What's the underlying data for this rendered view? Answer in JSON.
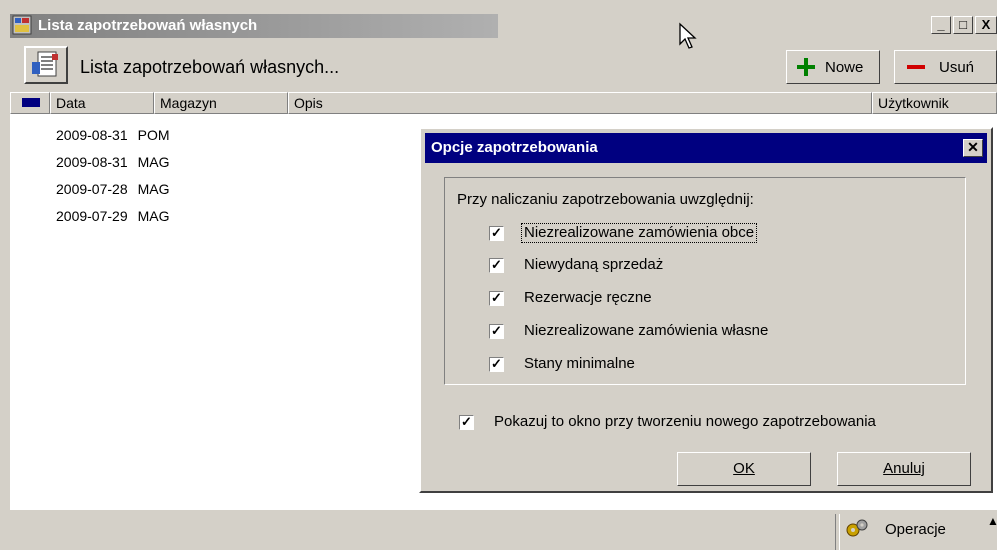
{
  "window": {
    "title": "Lista zapotrzebowań własnych",
    "minimize_label": "_",
    "maximize_label": "□",
    "close_label": "X"
  },
  "toolbar": {
    "title": "Lista zapotrzebowań własnych...",
    "new_label": "Nowe",
    "delete_label": "Usuń",
    "new_icon": "plus-icon",
    "delete_icon": "minus-icon"
  },
  "table": {
    "columns": [
      "Data",
      "Magazyn",
      "Opis",
      "Użytkownik"
    ],
    "rows": [
      {
        "date": "2009-08-31",
        "warehouse": "POM"
      },
      {
        "date": "2009-08-31",
        "warehouse": "MAG"
      },
      {
        "date": "2009-07-28",
        "warehouse": "MAG"
      },
      {
        "date": "2009-07-29",
        "warehouse": "MAG"
      }
    ]
  },
  "statusbar": {
    "operations_label": "Operacje",
    "operations_icon": "gears-icon"
  },
  "dialog": {
    "title": "Opcje zapotrzebowania",
    "close_label": "✕",
    "group_label": "Przy naliczaniu zapotrzebowania uwzględnij:",
    "options": [
      {
        "label": "Niezrealizowane zamówienia obce",
        "checked": true
      },
      {
        "label": "Niewydaną sprzedaż",
        "checked": true
      },
      {
        "label": "Rezerwacje ręczne",
        "checked": true
      },
      {
        "label": "Niezrealizowane zamówienia własne",
        "checked": true
      },
      {
        "label": "Stany minimalne",
        "checked": true
      }
    ],
    "show_on_new": {
      "label": "Pokazuj to okno przy tworzeniu nowego zapotrzebowania",
      "checked": true
    },
    "ok_label": "OK",
    "cancel_label": "Anuluj"
  },
  "colors": {
    "face": "#d4d0c8",
    "dialog_title": "#000080",
    "plus": "#008000",
    "minus": "#d00000"
  }
}
